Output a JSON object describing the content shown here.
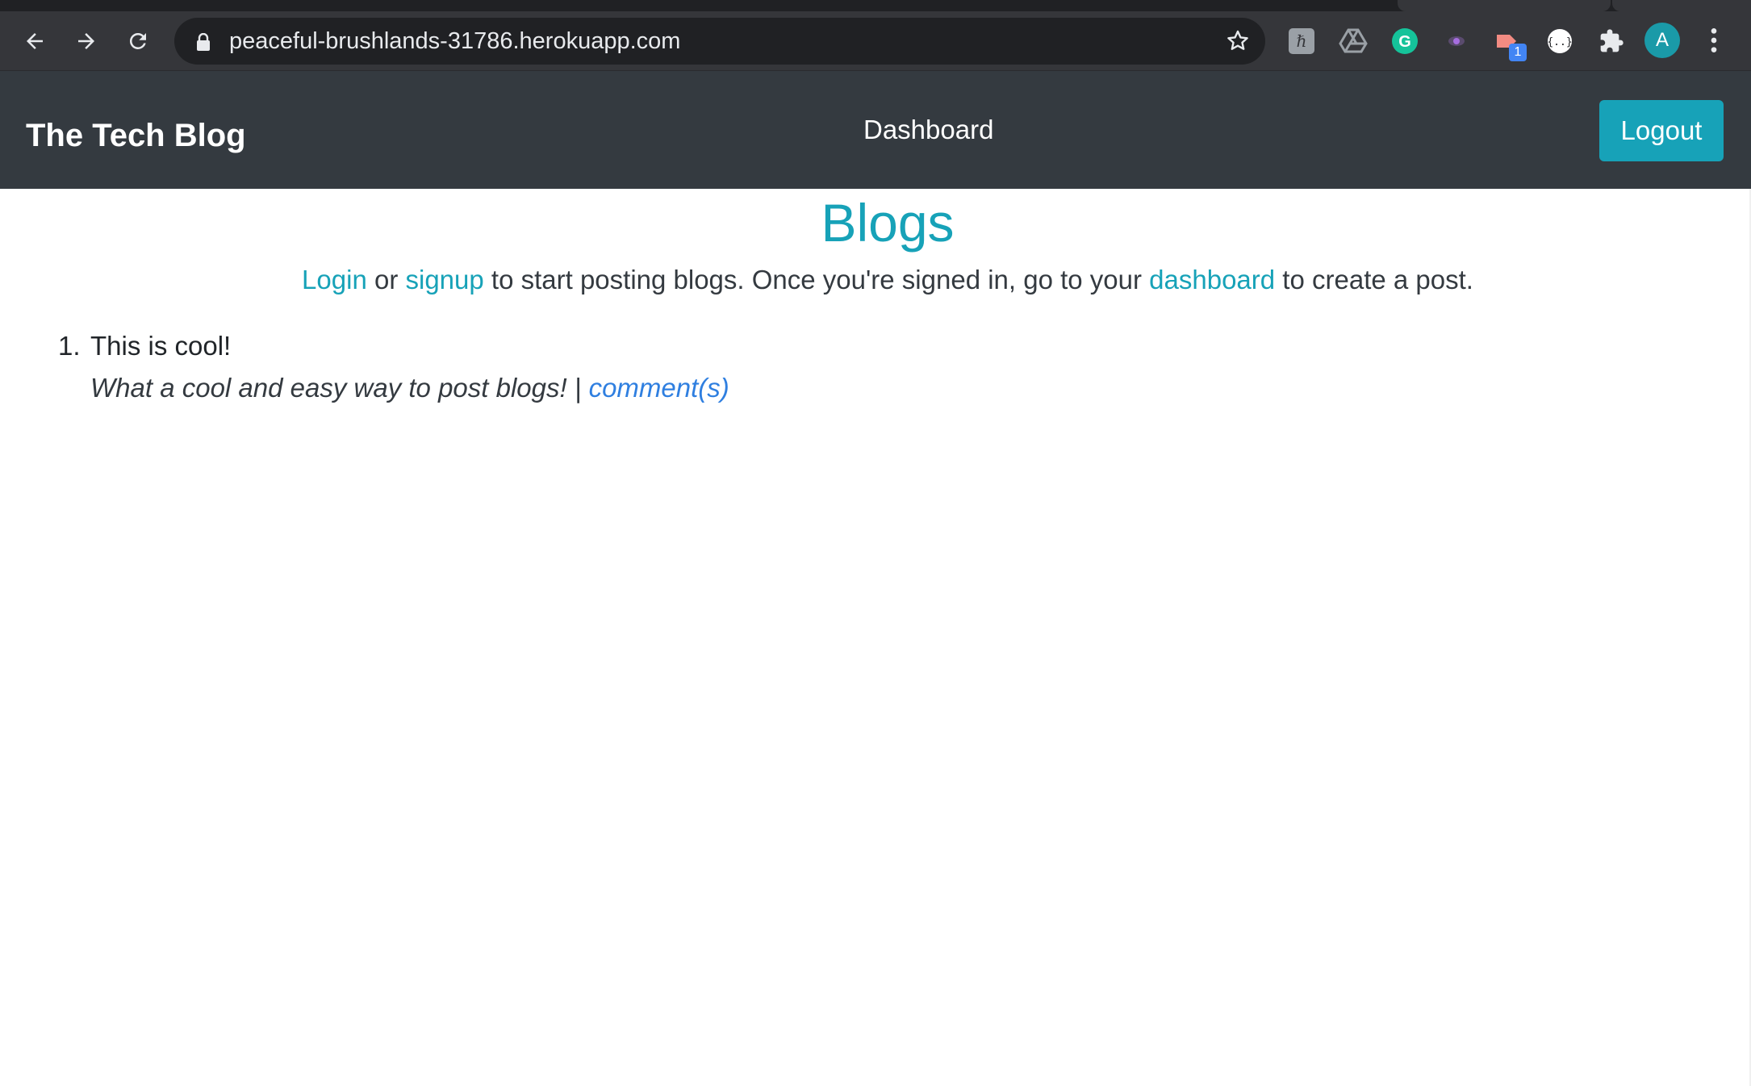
{
  "browser": {
    "url": "peaceful-brushlands-31786.herokuapp.com",
    "extension_badge": "1",
    "avatar_letter": "A"
  },
  "navbar": {
    "brand": "The Tech Blog",
    "dashboard_label": "Dashboard",
    "logout_label": "Logout"
  },
  "main": {
    "title": "Blogs",
    "intro": {
      "login_link": "Login",
      "or_text": " or ",
      "signup_link": "signup",
      "middle_text": " to start posting blogs. Once you're signed in, go to your ",
      "dashboard_link": "dashboard",
      "end_text": " to create a post."
    },
    "posts": [
      {
        "number": "1.",
        "title": "This is cool!",
        "summary": "What a cool and easy way to post blogs! | ",
        "comments_link": "comment(s)"
      }
    ]
  },
  "colors": {
    "navbar_bg": "#343a40",
    "accent": "#17a2b8",
    "link_blue": "#2f7fe0"
  }
}
